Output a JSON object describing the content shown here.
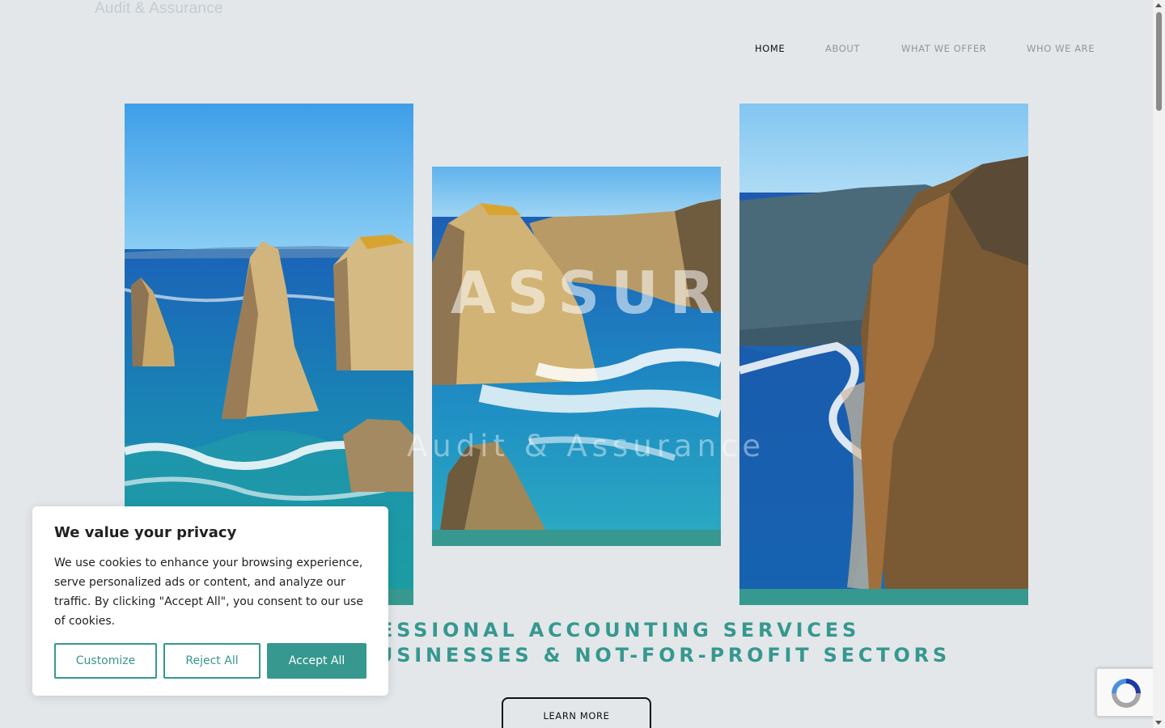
{
  "brand": {
    "logo_text": "Audit & Assurance"
  },
  "nav": {
    "items": [
      {
        "label": "HOME",
        "active": true
      },
      {
        "label": "ABOUT",
        "active": false
      },
      {
        "label": "WHAT WE OFFER",
        "active": false
      },
      {
        "label": "WHO WE ARE",
        "active": false
      }
    ]
  },
  "hero": {
    "word": "ASSUR",
    "subtitle": "Audit & Assurance",
    "tagline_line1": "PROFESSIONAL ACCOUNTING SERVICES",
    "tagline_line2": "FOR BUSINESSES & NOT-FOR-PROFIT SECTORS",
    "cta_label": "LEARN MORE"
  },
  "cookie_banner": {
    "title": "We value your privacy",
    "body": "We use cookies to enhance your browsing experience, serve personalized ads or content, and analyze our traffic. By clicking \"Accept All\", you consent to our use of cookies.",
    "customize_label": "Customize",
    "reject_label": "Reject All",
    "accept_label": "Accept All"
  },
  "colors": {
    "accent": "#36988f",
    "background": "#e3e7ea",
    "text_dark": "#111111",
    "nav_inactive": "#8e979c"
  }
}
